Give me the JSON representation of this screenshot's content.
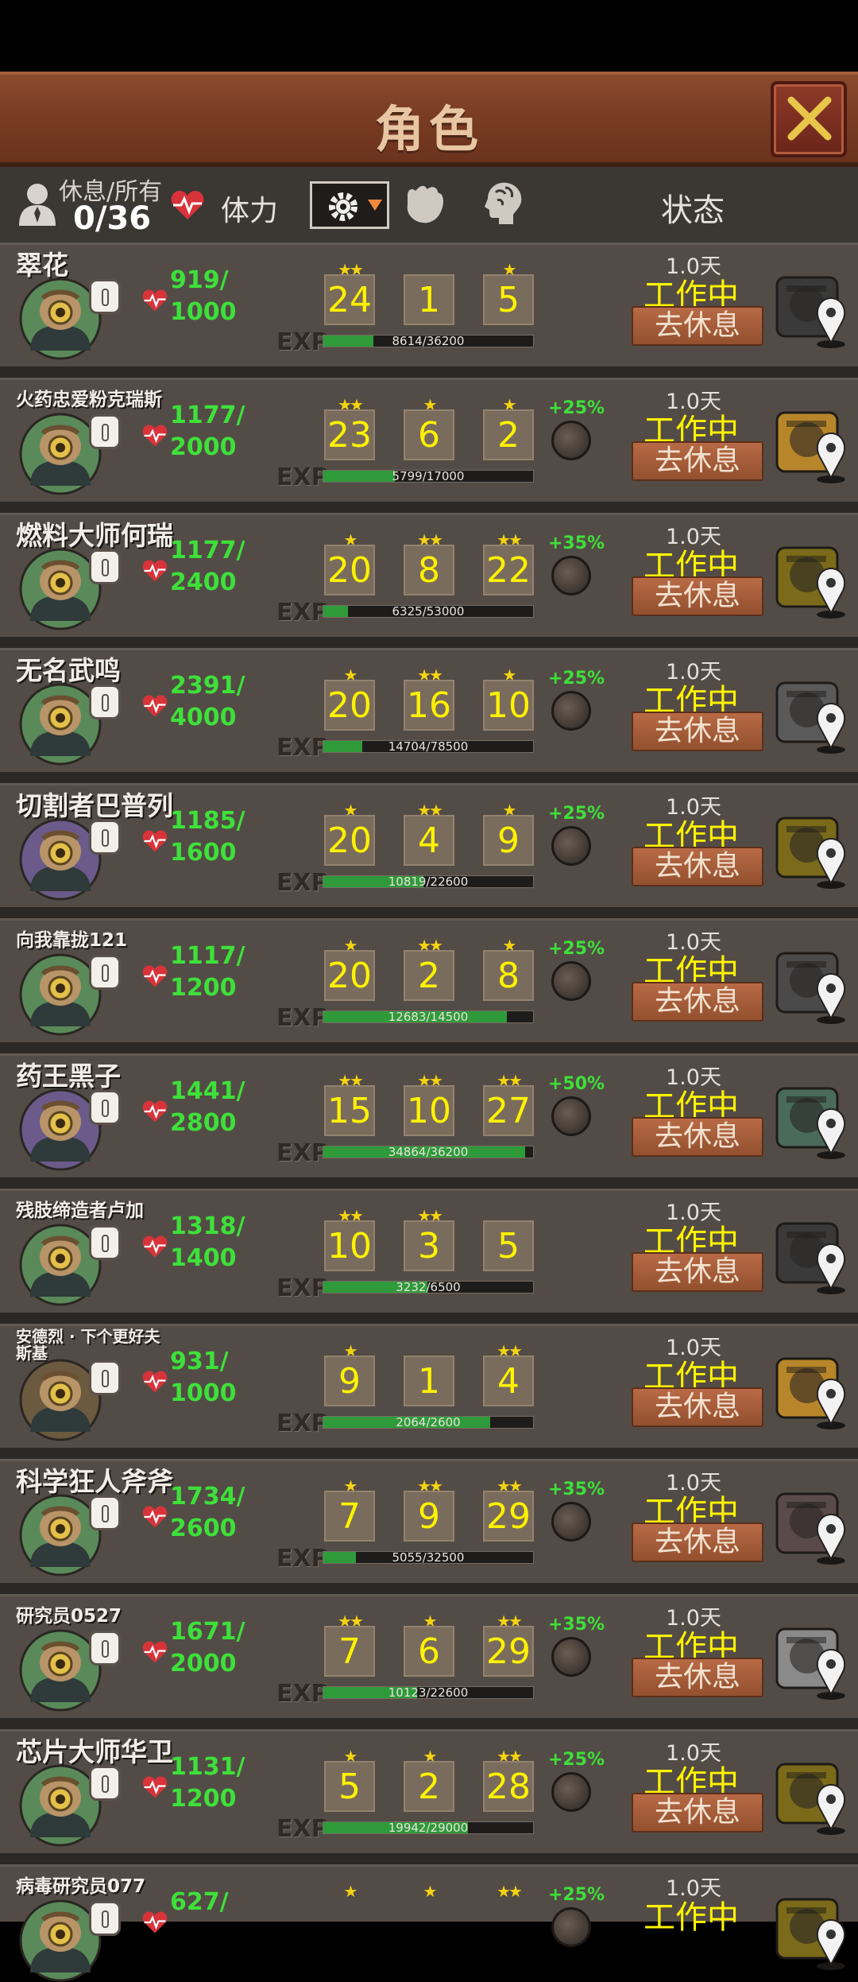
{
  "title": "角色",
  "header": {
    "rest_label": "休息/所有",
    "rest_value": "0/36",
    "stamina_label": "体力",
    "status_label": "状态"
  },
  "icons": [
    "close-icon",
    "user-icon",
    "heart-icon",
    "gear-filter-icon",
    "fist-icon",
    "brain-icon",
    "info-icon",
    "map-pin-icon"
  ],
  "colors": {
    "hp": "#3ee03a",
    "stat": "#fff200",
    "bonus": "#3ee03a",
    "star": "#f5d311"
  },
  "characters": [
    {
      "name": "翠花",
      "hp": "919/",
      "hp_max": "1000",
      "stars": [
        "★★",
        "",
        ""
      ],
      "stats": [
        "24",
        "1",
        "5"
      ],
      "stars3": "★",
      "exp_text": "8614/36200",
      "exp": 0.238,
      "bonus": "",
      "days": "1.0天",
      "status": "工作中",
      "rest_button": "去休息"
    },
    {
      "name": "火药忠爱粉克瑞斯",
      "hp": "1177/",
      "hp_max": "2000",
      "stars": [
        "★★",
        "★",
        "★"
      ],
      "stats": [
        "23",
        "6",
        "2"
      ],
      "exp_text": "5799/17000",
      "exp": 0.341,
      "bonus": "+25%",
      "days": "1.0天",
      "status": "工作中",
      "rest_button": "去休息"
    },
    {
      "name": "燃料大师何瑞",
      "hp": "1177/",
      "hp_max": "2400",
      "stars": [
        "★",
        "★★",
        "★★"
      ],
      "stats": [
        "20",
        "8",
        "22"
      ],
      "exp_text": "6325/53000",
      "exp": 0.119,
      "bonus": "+35%",
      "days": "1.0天",
      "status": "工作中",
      "rest_button": "去休息"
    },
    {
      "name": "无名武鸣",
      "hp": "2391/",
      "hp_max": "4000",
      "stars": [
        "★",
        "★★",
        "★"
      ],
      "stats": [
        "20",
        "16",
        "10"
      ],
      "exp_text": "14704/78500",
      "exp": 0.187,
      "bonus": "+25%",
      "days": "1.0天",
      "status": "工作中",
      "rest_button": "去休息"
    },
    {
      "name": "切割者巴普列",
      "hp": "1185/",
      "hp_max": "1600",
      "stars": [
        "★",
        "★★",
        "★"
      ],
      "stats": [
        "20",
        "4",
        "9"
      ],
      "exp_text": "10819/22600",
      "exp": 0.479,
      "bonus": "+25%",
      "days": "1.0天",
      "status": "工作中",
      "rest_button": "去休息"
    },
    {
      "name": "向我靠拢121",
      "hp": "1117/",
      "hp_max": "1200",
      "stars": [
        "★",
        "★★",
        "★"
      ],
      "stats": [
        "20",
        "2",
        "8"
      ],
      "exp_text": "12683/14500",
      "exp": 0.875,
      "bonus": "+25%",
      "days": "1.0天",
      "status": "工作中",
      "rest_button": "去休息"
    },
    {
      "name": "药王黑子",
      "hp": "1441/",
      "hp_max": "2800",
      "stars": [
        "★★",
        "★★",
        "★★"
      ],
      "stats": [
        "15",
        "10",
        "27"
      ],
      "exp_text": "34864/36200",
      "exp": 0.963,
      "bonus": "+50%",
      "days": "1.0天",
      "status": "工作中",
      "rest_button": "去休息"
    },
    {
      "name": "残肢缔造者卢加",
      "hp": "1318/",
      "hp_max": "1400",
      "stars": [
        "★★",
        "★★",
        ""
      ],
      "stats": [
        "10",
        "3",
        "5"
      ],
      "exp_text": "3232/6500",
      "exp": 0.497,
      "bonus": "",
      "days": "1.0天",
      "status": "工作中",
      "rest_button": "去休息"
    },
    {
      "name": "安德烈 · 下个更好夫斯基",
      "hp": "931/",
      "hp_max": "1000",
      "stars": [
        "★",
        "",
        "★★"
      ],
      "stats": [
        "9",
        "1",
        "4"
      ],
      "exp_text": "2064/2600",
      "exp": 0.794,
      "bonus": "",
      "days": "1.0天",
      "status": "工作中",
      "rest_button": "去休息"
    },
    {
      "name": "科学狂人斧斧",
      "hp": "1734/",
      "hp_max": "2600",
      "stars": [
        "★",
        "★★",
        "★★"
      ],
      "stats": [
        "7",
        "9",
        "29"
      ],
      "exp_text": "5055/32500",
      "exp": 0.156,
      "bonus": "+35%",
      "days": "1.0天",
      "status": "工作中",
      "rest_button": "去休息"
    },
    {
      "name": "研究员0527",
      "hp": "1671/",
      "hp_max": "2000",
      "stars": [
        "★★",
        "★",
        "★★"
      ],
      "stats": [
        "7",
        "6",
        "29"
      ],
      "exp_text": "10123/22600",
      "exp": 0.448,
      "bonus": "+35%",
      "days": "1.0天",
      "status": "工作中",
      "rest_button": "去休息"
    },
    {
      "name": "芯片大师华卫",
      "hp": "1131/",
      "hp_max": "1200",
      "stars": [
        "★",
        "★",
        "★★"
      ],
      "stats": [
        "5",
        "2",
        "28"
      ],
      "exp_text": "19942/29000",
      "exp": 0.688,
      "bonus": "+25%",
      "days": "1.0天",
      "status": "工作中",
      "rest_button": "去休息"
    },
    {
      "name": "病毒研究员077",
      "hp": "627/",
      "hp_max": "",
      "stars": [
        "★",
        "★",
        "★★"
      ],
      "stats": [
        "",
        "",
        ""
      ],
      "exp_text": "",
      "exp": 0,
      "bonus": "+25%",
      "days": "1.0天",
      "status": "工作中",
      "rest_button": ""
    }
  ]
}
